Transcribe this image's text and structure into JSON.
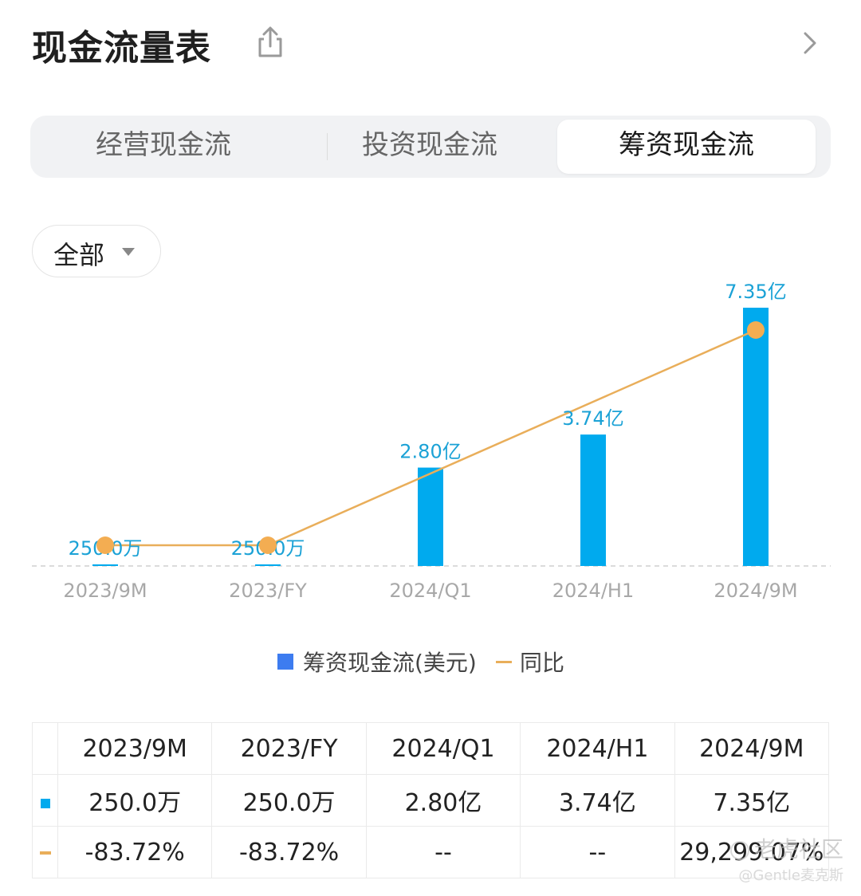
{
  "header": {
    "title": "现金流量表"
  },
  "tabs": [
    {
      "label": "经营现金流"
    },
    {
      "label": "投资现金流"
    },
    {
      "label": "筹资现金流"
    }
  ],
  "active_tab": 2,
  "filter": {
    "label": "全部"
  },
  "colors": {
    "bar": "#00aaee",
    "line": "#e9ae5a",
    "legend_square": "#3d7cf0",
    "negative": "#2bb36f",
    "positive": "#e0463c"
  },
  "legend": {
    "series1": "筹资现金流(美元)",
    "series2": "同比"
  },
  "chart_data": {
    "type": "bar",
    "categories": [
      "2023/9M",
      "2023/FY",
      "2024/Q1",
      "2024/H1",
      "2024/9M"
    ],
    "series": [
      {
        "name": "筹资现金流(美元)",
        "values": [
          2500000,
          2500000,
          280000000,
          374000000,
          735000000
        ],
        "data_labels": [
          "250.0万",
          "250.0万",
          "2.80亿",
          "3.74亿",
          "7.35亿"
        ]
      },
      {
        "name": "同比",
        "type": "line",
        "values": [
          -83.72,
          -83.72,
          null,
          null,
          29299.07
        ]
      }
    ],
    "legend": "bottom-center"
  },
  "table": {
    "headers": [
      "2023/9M",
      "2023/FY",
      "2024/Q1",
      "2024/H1",
      "2024/9M"
    ],
    "rows": [
      {
        "marker": "bar",
        "cells": [
          "250.0万",
          "250.0万",
          "2.80亿",
          "3.74亿",
          "7.35亿"
        ]
      },
      {
        "marker": "line",
        "cells": [
          "-83.72%",
          "-83.72%",
          "--",
          "--",
          "29,299.07%"
        ]
      }
    ]
  },
  "watermark": {
    "line1": "老虎社区",
    "line2": "@Gentle麦克斯"
  }
}
